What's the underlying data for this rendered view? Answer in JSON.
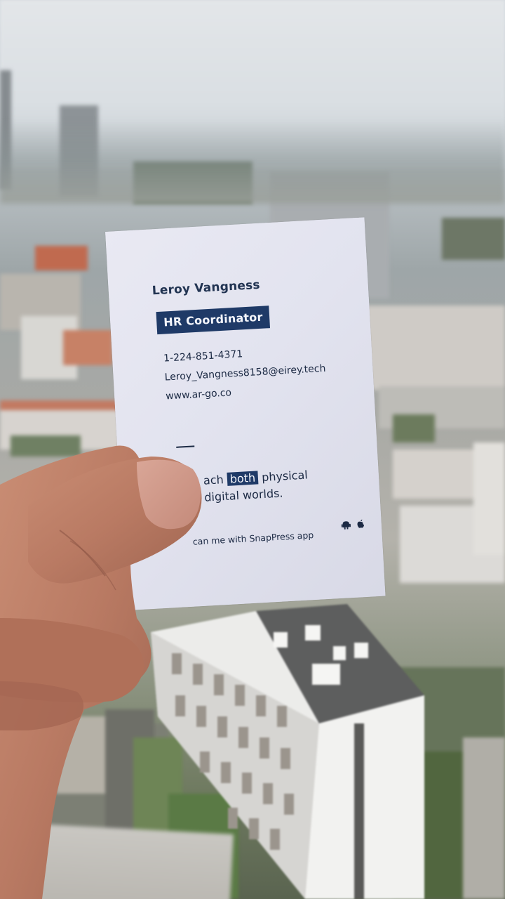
{
  "card": {
    "name": "Leroy Vangness",
    "title": "HR Coordinator",
    "phone": "1-224-851-4371",
    "email": "Leroy_Vangness8158@eirey.tech",
    "website": "www.ar-go.co",
    "tagline_line1_pre": "ach ",
    "tagline_highlight": "both",
    "tagline_line1_post": " physical",
    "tagline_line2": "digital worlds.",
    "scan_text": "can me with SnapPress app",
    "icons": [
      "android-icon",
      "apple-icon"
    ]
  },
  "colors": {
    "card_background": "#e4e5f0",
    "badge": "#1f3a67",
    "text": "#1c2a44"
  }
}
